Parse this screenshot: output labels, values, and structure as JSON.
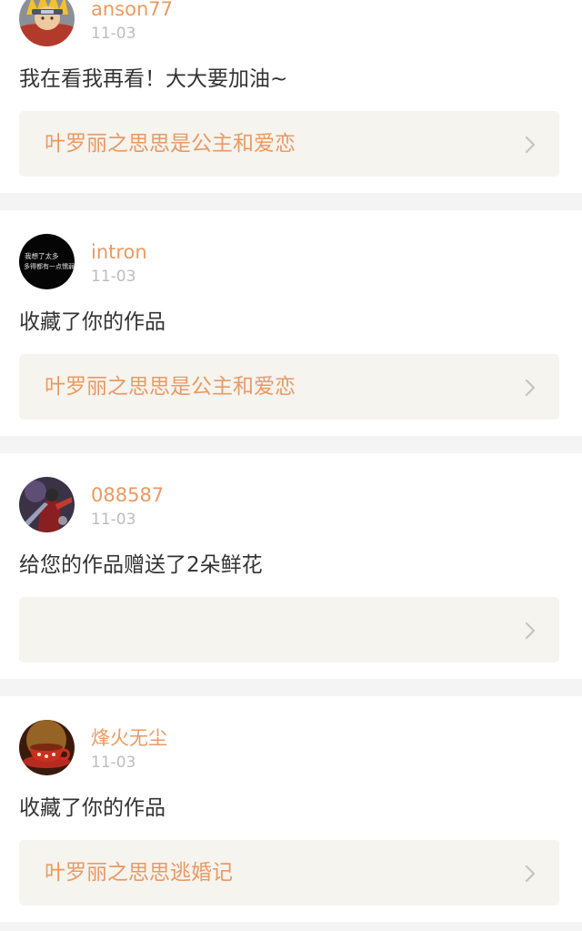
{
  "feed": {
    "items": [
      {
        "username": "anson77",
        "date": "11-03",
        "message": "我在看我再看！大大要加油~",
        "work_title": "叶罗丽之思思是公主和爱恋",
        "avatar_icon": "anime-character-avatar"
      },
      {
        "username": "intron",
        "date": "11-03",
        "message": "收藏了你的作品",
        "work_title": "叶罗丽之思思是公主和爱恋",
        "avatar_icon": "text-avatar",
        "avatar_text": [
          "我想了太多",
          "多得都有一点懦弱"
        ]
      },
      {
        "username": "088587",
        "date": "11-03",
        "message": "给您的作品赠送了2朵鲜花",
        "work_title": "",
        "avatar_icon": "game-character-avatar"
      },
      {
        "username": "烽火无尘",
        "date": "11-03",
        "message": "收藏了你的作品",
        "work_title": "叶罗丽之思思逃婚记",
        "avatar_icon": "tea-cup-avatar"
      }
    ]
  },
  "colors": {
    "username": "#ea9a63",
    "work_title": "#ea9a63",
    "date": "#bdbdbd",
    "message": "#333333",
    "link_background": "#f5f4ef",
    "separator": "#f4f4f4",
    "chevron": "#c4c4c4"
  }
}
